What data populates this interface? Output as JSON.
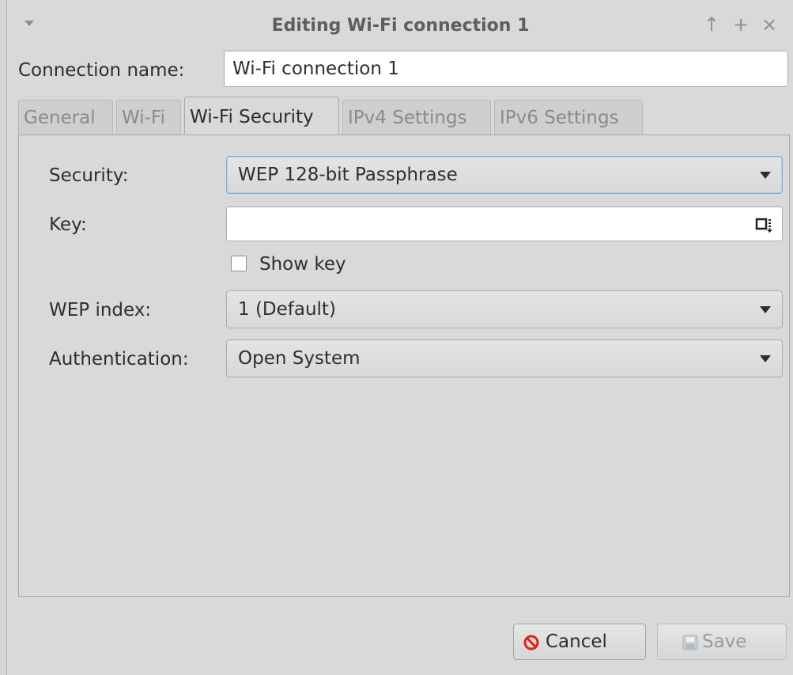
{
  "window": {
    "title": "Editing Wi-Fi connection 1",
    "menu_icon": "chevron-down-icon",
    "controls": {
      "up": "↑",
      "maximize": "+",
      "close": "×"
    }
  },
  "connection": {
    "label": "Connection name:",
    "value": "Wi-Fi connection 1"
  },
  "tabs": [
    {
      "label": "General"
    },
    {
      "label": "Wi-Fi"
    },
    {
      "label": "Wi-Fi Security",
      "active": true
    },
    {
      "label": "IPv4 Settings"
    },
    {
      "label": "IPv6 Settings"
    }
  ],
  "security": {
    "security_label": "Security:",
    "security_value": "WEP 128-bit Passphrase",
    "key_label": "Key:",
    "key_value": "",
    "show_key_label": "Show key",
    "wep_index_label": "WEP index:",
    "wep_index_value": "1 (Default)",
    "auth_label": "Authentication:",
    "auth_value": "Open System"
  },
  "buttons": {
    "cancel": "Cancel",
    "save": "Save"
  },
  "colors": {
    "accent_focus": "#8aa9cf",
    "cancel_icon": "#e0201b"
  }
}
